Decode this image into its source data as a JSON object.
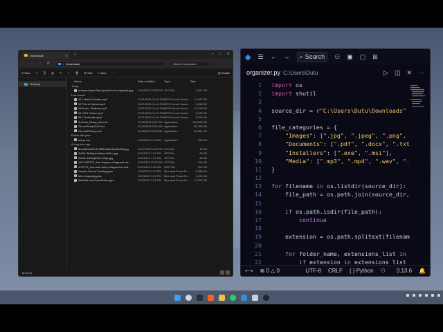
{
  "explorer": {
    "tab_title": "Downloads",
    "breadcrumb": "Downloads",
    "search_placeholder": "Search Downloads",
    "toolbar": {
      "new_label": "New",
      "sort_label": "Sort",
      "view_label": "View",
      "details_label": "Details"
    },
    "sidebar": [
      {
        "label": "Desktop"
      }
    ],
    "columns": {
      "name": "Name",
      "date": "Date modified",
      "type": "Type",
      "size": "Size"
    },
    "groups": [
      {
        "label": "Today",
        "files": [
          {
            "name": "antique-tripod-9a4d-(mp0v1e0-unsplash).jpg",
            "date": "12/4/2025 12:59 PM",
            "type": "JPG File",
            "size": "1,657 KB"
          }
        ]
      },
      {
        "label": "Last month",
        "files": [
          {
            "name": "01 I Need A Doctor.mp3",
            "date": "11/21/2025 11:46 PM",
            "type": "MP3 Format Sound",
            "size": "12,627 KB"
          },
          {
            "name": "02 This is Detroit.mp3",
            "date": "11/21/2025 11:46 PM",
            "type": "MP3 Format Sound",
            "size": "5,898 KB"
          },
          {
            "name": "03 Kush - Maleory.mp3",
            "date": "11/21/2025 11:46 PM",
            "type": "MP3 Format Sound",
            "size": "10,728 KB"
          },
          {
            "name": "04 VGH Online.mp3",
            "date": "11/21/2025 11:46 PM",
            "type": "MP3 Format Sound",
            "size": "8,783 KB"
          },
          {
            "name": "05 I Dominate.mp3",
            "date": "11/21/2025 11:46 PM",
            "type": "MP3 Format Sound",
            "size": "8,210 KB"
          },
          {
            "name": "3uTools_Setup_x64.exe",
            "date": "11/18/2025 3:26 PM",
            "type": "Application",
            "size": "199,815 KB"
          },
          {
            "name": "iTunesSetup1012.exe",
            "date": "11/18/2025 3:04 AM",
            "type": "Application",
            "size": "80,765 KB"
          },
          {
            "name": "iTunes32Setup.exe",
            "date": "11/18/2025 2:05 AM",
            "type": "Application",
            "size": "53,854 KB"
          }
        ]
      },
      {
        "label": "Earlier this year",
        "files": [
          {
            "name": "setup.exe",
            "date": "10/6/2025 8:44 PM",
            "type": "Application",
            "size": "105 KB"
          }
        ]
      },
      {
        "label": "A long time ago",
        "files": [
          {
            "name": "6b0d6b5a9f4d11505b6a0fe5a48b695.jpg",
            "date": "11/27/2022 4:25 PM",
            "type": "JPG File",
            "size": "49 KB"
          },
          {
            "name": "2s891-8b9bgxl4a6ew-r9d4m.jpg",
            "date": "5/31/2022 7:21 PM",
            "type": "JPG File",
            "size": "83 KB"
          },
          {
            "name": "2s891-8s0b3j03W-w9fyz.jpg",
            "date": "5/31/2022 7:21 PM",
            "type": "JPG File",
            "size": "33 KB"
          },
          {
            "name": "182-7822371_free-league-of-legends-wa...",
            "date": "5/30/2022 12:37 AM",
            "type": "JPG File",
            "size": "234 KB"
          },
          {
            "name": "3-37074_rick-and-morty-images-rick-and...",
            "date": "5/31/2022 2:06 PM",
            "type": "PNG File",
            "size": "829 KB"
          },
          {
            "name": "Hexelio Scrum Training.pptx",
            "date": "2/23/2020 3:22 PM",
            "type": "Microsoft PowerPo...",
            "size": "5,288 KB"
          },
          {
            "name": "Mind mapping.pptx",
            "date": "2/23/2020 3:22 PM",
            "type": "Microsoft PowerPo...",
            "size": "2,225 KB"
          },
          {
            "name": "SeleNet and KneeNoise.pptx",
            "date": "2/23/2020 3:22 PM",
            "type": "Microsoft PowerPo...",
            "size": "12,252 KB"
          }
        ]
      }
    ],
    "status": "18 items"
  },
  "vscode": {
    "search_label": "Search",
    "tab_name": "organizer.py",
    "tab_path": "C:\\Users\\Dutu",
    "line_numbers": [
      "1",
      "2",
      "3",
      "4",
      "5",
      "6",
      "7",
      "8",
      "9",
      "10",
      "11",
      "12",
      "13",
      "14",
      "15",
      "16",
      "17",
      "18",
      "19",
      "20",
      "21",
      "22"
    ],
    "status": {
      "errors": "0",
      "warnings": "0",
      "encoding": "UTF-8",
      "eol": "CRLF",
      "language": "Python",
      "version": "3.13.6"
    },
    "accent": "#2f8fde"
  },
  "taskbar": {
    "icons": [
      "windows-icon",
      "search-icon",
      "task-view-icon",
      "brave-icon",
      "folder-icon",
      "spotify-icon",
      "vscode-icon",
      "file-icon",
      "steam-icon"
    ]
  }
}
